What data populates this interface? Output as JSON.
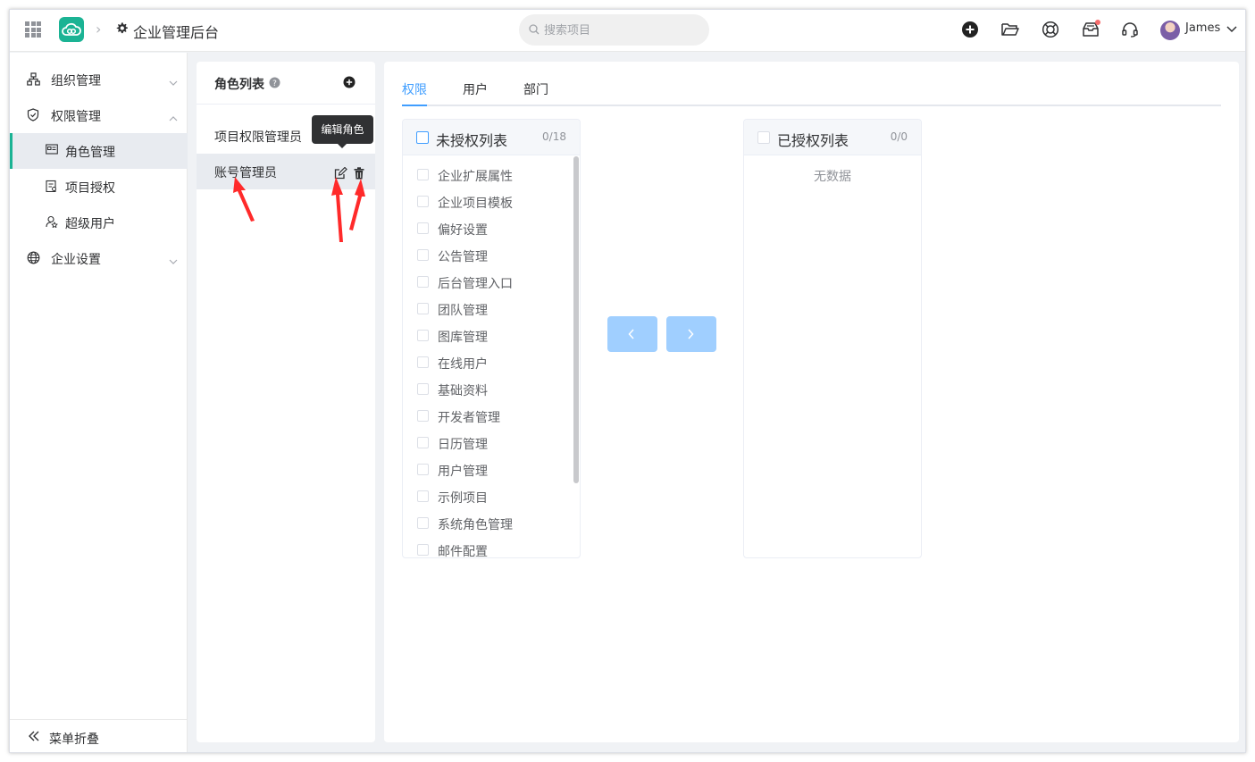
{
  "header": {
    "app_title": "企业管理后台",
    "search_placeholder": "搜索项目",
    "user_name": "James"
  },
  "sidebar": {
    "items": [
      {
        "label": "组织管理",
        "icon": "org-icon"
      },
      {
        "label": "权限管理",
        "icon": "shield-icon",
        "children": [
          {
            "label": "角色管理",
            "icon": "id-card-icon",
            "active": true
          },
          {
            "label": "项目授权",
            "icon": "clipboard-icon"
          },
          {
            "label": "超级用户",
            "icon": "user-star-icon"
          }
        ]
      },
      {
        "label": "企业设置",
        "icon": "globe-icon"
      }
    ],
    "collapse_label": "菜单折叠"
  },
  "roles": {
    "title": "角色列表",
    "items": [
      {
        "label": "项目权限管理员"
      },
      {
        "label": "账号管理员",
        "active": true
      }
    ],
    "tooltip": "编辑角色"
  },
  "tabs": [
    {
      "label": "权限",
      "active": true
    },
    {
      "label": "用户"
    },
    {
      "label": "部门"
    }
  ],
  "transfer": {
    "left": {
      "title": "未授权列表",
      "count": "0/18",
      "items": [
        "企业扩展属性",
        "企业项目模板",
        "偏好设置",
        "公告管理",
        "后台管理入口",
        "团队管理",
        "图库管理",
        "在线用户",
        "基础资料",
        "开发者管理",
        "日历管理",
        "用户管理",
        "示例项目",
        "系统角色管理",
        "邮件配置"
      ]
    },
    "right": {
      "title": "已授权列表",
      "count": "0/0",
      "empty_text": "无数据"
    }
  },
  "colors": {
    "brand": "#1bb394",
    "primary": "#409eff",
    "button_disabled": "#a0cfff",
    "annotation_arrow": "#ff2a2a"
  }
}
